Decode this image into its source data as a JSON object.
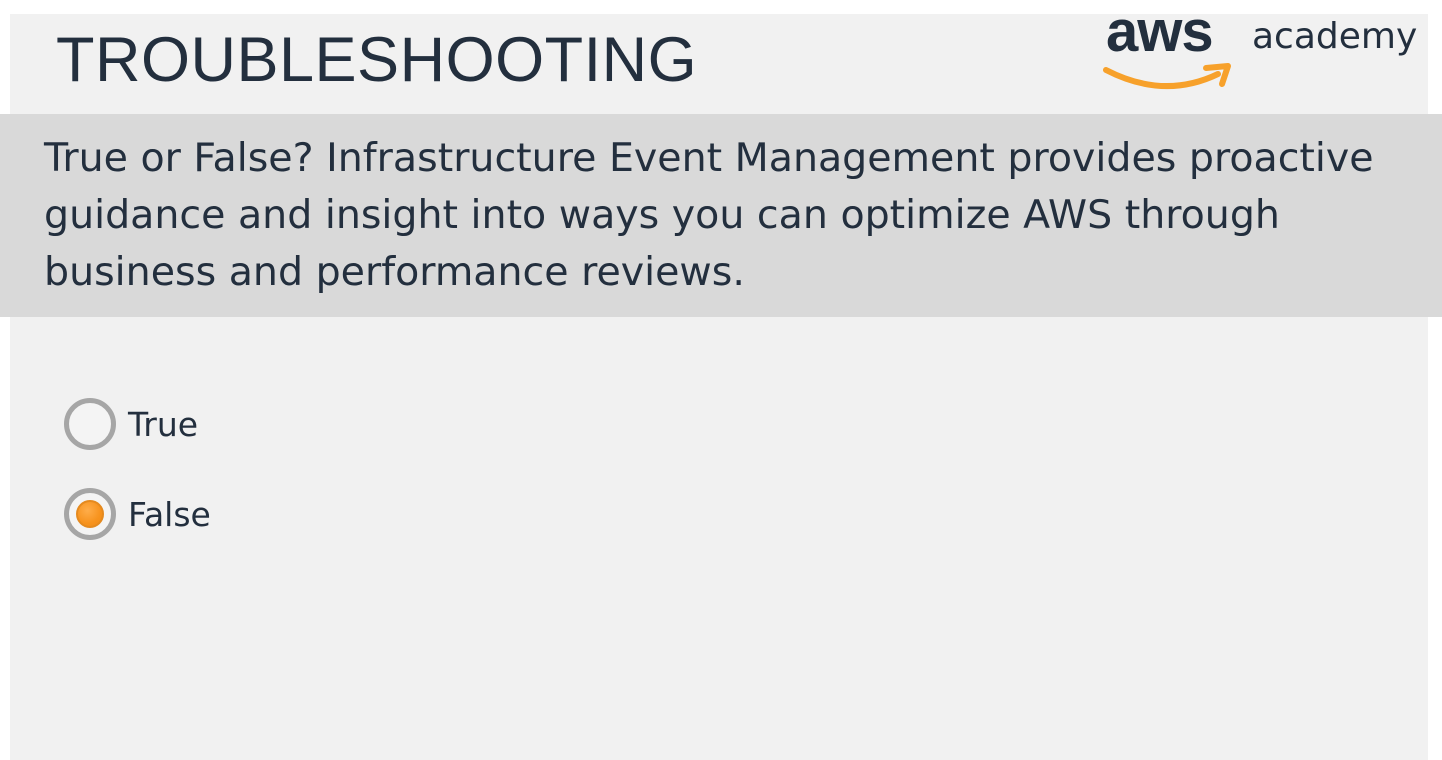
{
  "header": {
    "title": "TROUBLESHOOTING",
    "logo": {
      "mark_text": "aws",
      "wordmark_text": "academy",
      "text_color": "#232f3e",
      "smile_color": "#f7a12b"
    }
  },
  "question": {
    "text": "True or False? Infrastructure Event Management provides proactive guidance and insight into ways you can optimize AWS through business and performance reviews."
  },
  "options": [
    {
      "label": "True",
      "selected": false
    },
    {
      "label": "False",
      "selected": true
    }
  ],
  "colors": {
    "text": "#232f3e",
    "slide_background": "#f1f1f1",
    "question_band": "#d9d9d9",
    "radio_selected": "#f7931e",
    "radio_border": "#a6a6a6"
  }
}
